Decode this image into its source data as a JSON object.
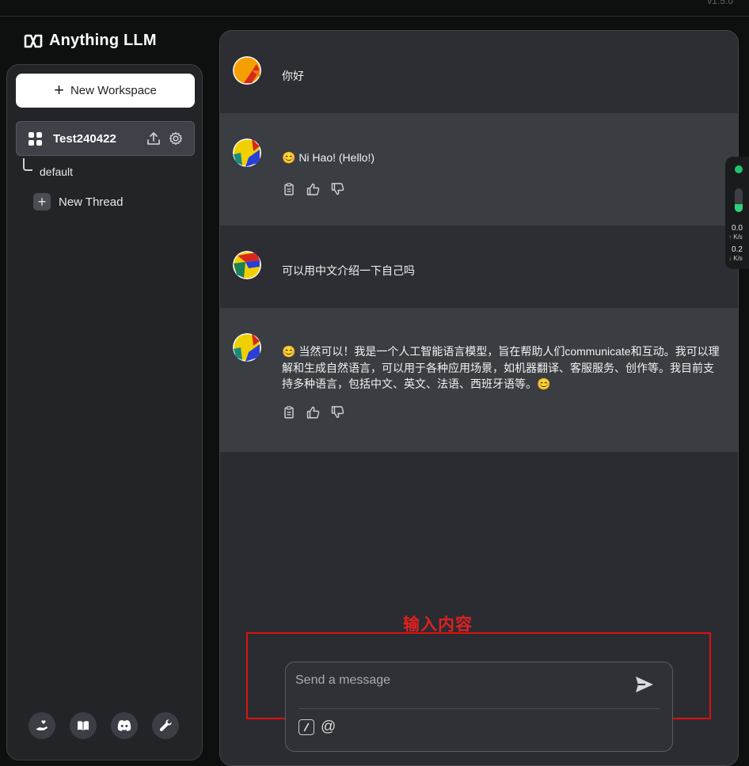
{
  "app": {
    "version": "v1.5.0",
    "name": "Anything LLM"
  },
  "sidebar": {
    "new_workspace_label": "New Workspace",
    "workspace": {
      "name": "Test240422"
    },
    "thread_default": "default",
    "new_thread_label": "New Thread"
  },
  "chat": {
    "messages": [
      {
        "role": "user",
        "text": "你好"
      },
      {
        "role": "assistant",
        "text": "😊 Ni Hao! (Hello!)"
      },
      {
        "role": "user",
        "text": "可以用中文介绍一下自己吗"
      },
      {
        "role": "assistant",
        "text": "😊 当然可以！我是一个人工智能语言模型，旨在帮助人们communicate和互动。我可以理解和生成自然语言，可以用于各种应用场景，如机器翻译、客服服务、创作等。我目前支持多种语言，包括中文、英文、法语、西班牙语等。😊"
      }
    ]
  },
  "input": {
    "placeholder": "Send a message",
    "value": ""
  },
  "annotation": {
    "text": "输入内容"
  },
  "network_widget": {
    "upload_speed": "0.0",
    "upload_unit": "K/s",
    "download_speed": "0.2",
    "download_unit": "K/s",
    "level": 0.35
  },
  "colors": {
    "background": "#0e0f0f",
    "panel": "#2a2c31",
    "assistant_row": "#3a3d42",
    "annotation_red": "#e01010",
    "status_green": "#20c46a"
  }
}
